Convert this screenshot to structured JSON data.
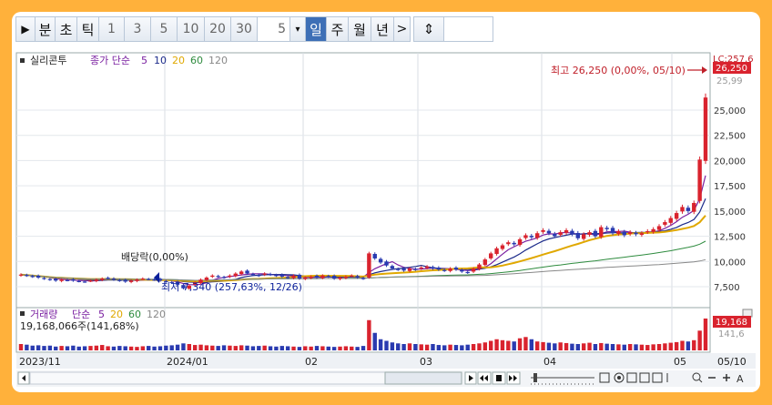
{
  "toolbar": {
    "play": "▶",
    "minute": "분",
    "second": "초",
    "tick": "틱",
    "n1": "1",
    "n3": "3",
    "n5": "5",
    "n10": "10",
    "n20": "20",
    "n30": "30",
    "period_value": "5",
    "dropdown": "▾",
    "day": "일",
    "week": "주",
    "month": "월",
    "year": "년",
    "more": ">",
    "split": "⇕",
    "code_input": ""
  },
  "price_pane": {
    "stock_name": "실리콘투",
    "legend_prefix": "종가 단순",
    "ma": [
      {
        "label": "5",
        "color": "#7a1fa0"
      },
      {
        "label": "10",
        "color": "#1b2a8a"
      },
      {
        "label": "20",
        "color": "#e0a800"
      },
      {
        "label": "60",
        "color": "#2e8b3e"
      },
      {
        "label": "120",
        "color": "#888888"
      }
    ],
    "high_annotation": "최고 26,250 (0,00%, 05/10)",
    "low_annotation": "최저 7,340 (257,63%, 12/26)",
    "dividend_annotation": "배당락(0,00%)",
    "current_price_tag": "26,250",
    "lc_tag": "LC:257,6",
    "y_ticks": [
      "25,000",
      "22,500",
      "20,000",
      "17,500",
      "15,000",
      "12,500",
      "10,000",
      "7,500"
    ],
    "partial_tick": "25,99"
  },
  "volume_pane": {
    "title": "거래량",
    "legend_prefix": "단순",
    "ma": [
      {
        "label": "5",
        "color": "#7a1fa0"
      },
      {
        "label": "20",
        "color": "#e0a800"
      },
      {
        "label": "60",
        "color": "#2e8b3e"
      },
      {
        "label": "120",
        "color": "#888888"
      }
    ],
    "value_line": "19,168,066주(141,68%)",
    "current_tag": "19,168",
    "ratio_tag": "141,6"
  },
  "x_axis": [
    "2023/11",
    "2024/01",
    "02",
    "03",
    "04",
    "05",
    "05/10"
  ],
  "colors": {
    "up": "#d9232e",
    "down": "#2a3bb0",
    "frame": "#ffb13b"
  },
  "chart_data": {
    "type": "candlestick",
    "ylim": [
      6500,
      27000
    ],
    "close_series": [
      8700,
      8600,
      8500,
      8400,
      8300,
      8200,
      8100,
      8200,
      8150,
      8100,
      8050,
      8000,
      8100,
      8200,
      8300,
      8350,
      8200,
      8100,
      8000,
      8100,
      8200,
      8300,
      8250,
      8200,
      8100,
      8000,
      7900,
      7700,
      7340,
      7600,
      7900,
      8200,
      8400,
      8600,
      8500,
      8400,
      8600,
      8800,
      9000,
      8800,
      8700,
      8600,
      8800,
      8700,
      8600,
      8500,
      8400,
      8600,
      8300,
      8400,
      8500,
      8400,
      8600,
      8500,
      8300,
      8400,
      8500,
      8600,
      8400,
      8300,
      10800,
      10300,
      9900,
      9600,
      9300,
      9200,
      9100,
      9300,
      9200,
      9400,
      9500,
      9300,
      9200,
      9100,
      9300,
      9200,
      9000,
      8900,
      9300,
      9700,
      10200,
      10800,
      11300,
      11600,
      11900,
      11700,
      12200,
      12600,
      12400,
      12800,
      13100,
      12800,
      12500,
      12900,
      13100,
      12700,
      12300,
      12700,
      12900,
      12500,
      13400,
      13200,
      12800,
      13000,
      12600,
      12900,
      12700,
      12800,
      13000,
      13200,
      13500,
      13900,
      14300,
      14800,
      15400,
      15000,
      15800,
      20100,
      26250
    ],
    "volume_relative": [
      0.2,
      0.18,
      0.15,
      0.16,
      0.14,
      0.15,
      0.12,
      0.14,
      0.13,
      0.15,
      0.12,
      0.13,
      0.14,
      0.15,
      0.17,
      0.13,
      0.12,
      0.14,
      0.13,
      0.12,
      0.11,
      0.13,
      0.14,
      0.12,
      0.13,
      0.15,
      0.16,
      0.18,
      0.22,
      0.2,
      0.17,
      0.18,
      0.16,
      0.15,
      0.14,
      0.16,
      0.15,
      0.14,
      0.16,
      0.15,
      0.13,
      0.14,
      0.15,
      0.13,
      0.12,
      0.14,
      0.13,
      0.12,
      0.11,
      0.13,
      0.12,
      0.14,
      0.13,
      0.12,
      0.11,
      0.12,
      0.13,
      0.12,
      0.11,
      0.14,
      0.95,
      0.55,
      0.35,
      0.3,
      0.25,
      0.22,
      0.2,
      0.22,
      0.2,
      0.19,
      0.18,
      0.2,
      0.17,
      0.16,
      0.18,
      0.17,
      0.16,
      0.18,
      0.2,
      0.22,
      0.25,
      0.3,
      0.35,
      0.32,
      0.3,
      0.28,
      0.38,
      0.42,
      0.35,
      0.28,
      0.26,
      0.24,
      0.22,
      0.25,
      0.23,
      0.21,
      0.2,
      0.22,
      0.24,
      0.2,
      0.23,
      0.21,
      0.2,
      0.19,
      0.18,
      0.2,
      0.19,
      0.18,
      0.17,
      0.19,
      0.2,
      0.22,
      0.24,
      0.26,
      0.3,
      0.28,
      0.32,
      0.62,
      1.0
    ]
  }
}
